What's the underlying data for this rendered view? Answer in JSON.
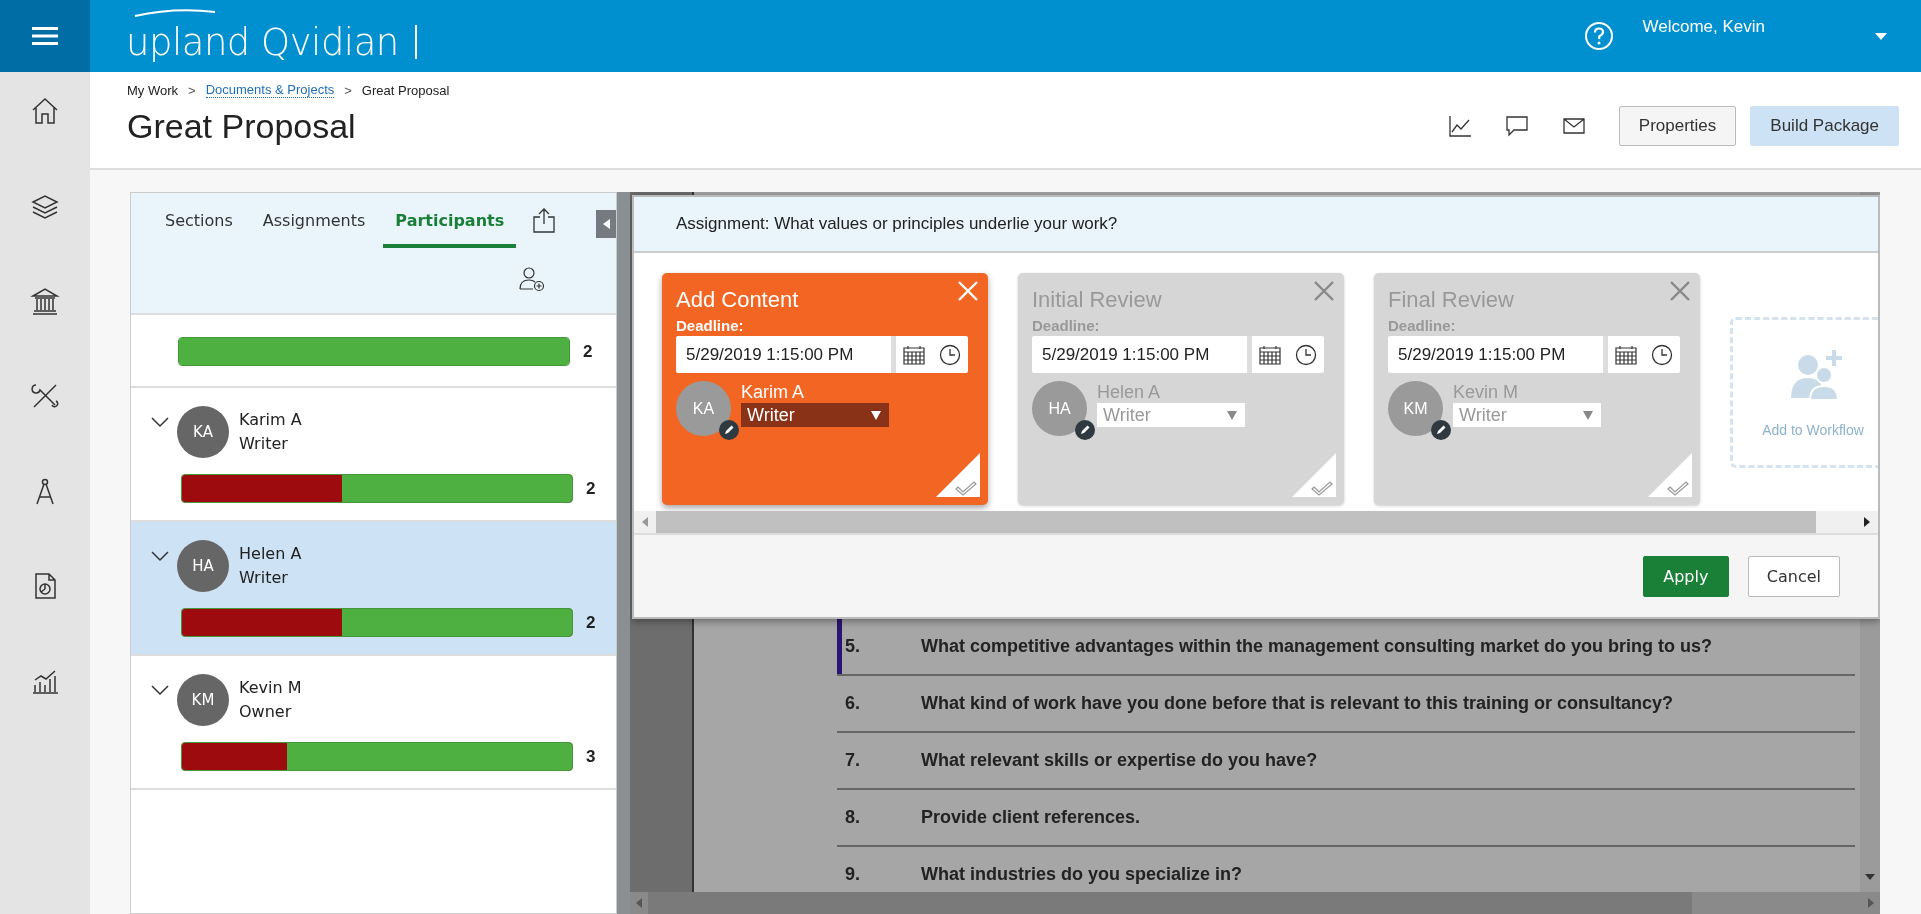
{
  "topbar": {
    "logo": "upland Qvidian",
    "welcome": "Welcome, Kevin"
  },
  "breadcrumb": {
    "separator": ">",
    "items": [
      {
        "label": "My Work",
        "link": false
      },
      {
        "label": "Documents & Projects",
        "link": true
      },
      {
        "label": "Great Proposal",
        "link": false
      }
    ]
  },
  "title": "Great Proposal",
  "header_buttons": [
    {
      "label": "Properties",
      "primary": false
    },
    {
      "label": "Build Package",
      "primary": true
    }
  ],
  "tabs": [
    {
      "label": "Sections",
      "selected": false
    },
    {
      "label": "Assignments",
      "selected": false
    },
    {
      "label": "Participants",
      "selected": true
    }
  ],
  "participants": [
    {
      "level": 1,
      "count": "2",
      "selected": false
    },
    {
      "initials": "KA",
      "name": "Karim A",
      "role": "Writer",
      "level": 0.59,
      "count": "2",
      "selected": false
    },
    {
      "initials": "HA",
      "name": "Helen A",
      "role": "Writer",
      "level": 0.59,
      "count": "2",
      "selected": true
    },
    {
      "initials": "KM",
      "name": "Kevin M",
      "role": "Owner",
      "level": 0.73,
      "count": "3",
      "selected": false
    }
  ],
  "assignment": "Assignment: What values or principles underlie your work?",
  "steps": [
    {
      "title": "Add Content",
      "deadline_label": "Deadline:",
      "deadline": "5/29/2019 1:15:00 PM",
      "initials": "KA",
      "assignee": "Karim A",
      "role": "Writer",
      "selected": true
    },
    {
      "title": "Initial Review",
      "deadline_label": "Deadline:",
      "deadline": "5/29/2019 1:15:00 PM",
      "initials": "HA",
      "assignee": "Helen A",
      "role": "Writer",
      "selected": false
    },
    {
      "title": "Final Review",
      "deadline_label": "Deadline:",
      "deadline": "5/29/2019 1:15:00 PM",
      "initials": "KM",
      "assignee": "Kevin M",
      "role": "Writer",
      "selected": false
    }
  ],
  "add_tile": {
    "label": "Add to Workflow"
  },
  "buttons": [
    {
      "label": "Apply",
      "primary": true
    },
    {
      "label": "Cancel",
      "primary": false
    }
  ],
  "questions": [
    {
      "number": "5.",
      "text": "What competitive advantages within the management consulting market do you bring to us?",
      "marked": true
    },
    {
      "number": "6.",
      "text": "What kind of work have you done before that is relevant to this training or consultancy?",
      "marked": false
    },
    {
      "number": "7.",
      "text": "What relevant skills or expertise do you have?",
      "marked": false
    },
    {
      "number": "8.",
      "text": "Provide client references.",
      "marked": false
    },
    {
      "number": "9.",
      "text": "What industries do you specialize in?",
      "marked": false
    }
  ]
}
